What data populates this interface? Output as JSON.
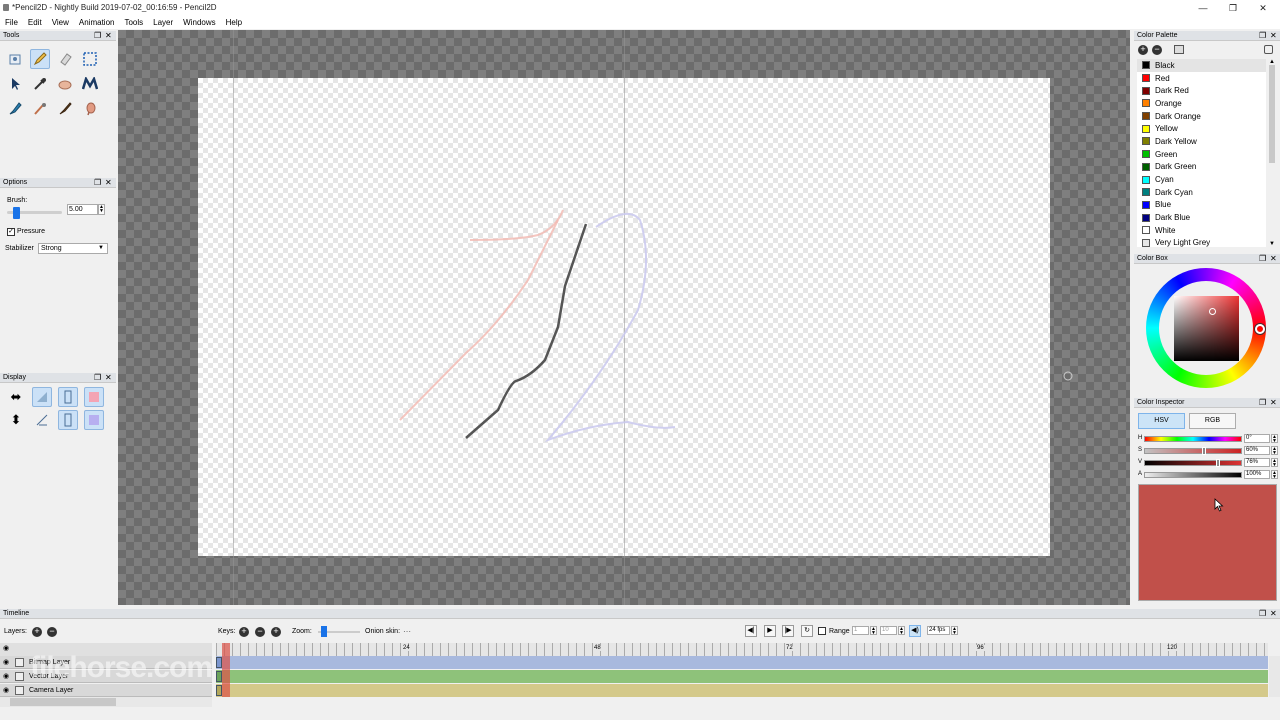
{
  "window": {
    "title": "*Pencil2D - Nightly Build 2019-07-02_00:16:59 - Pencil2D"
  },
  "menu": [
    "File",
    "Edit",
    "View",
    "Animation",
    "Tools",
    "Layer",
    "Windows",
    "Help"
  ],
  "panels": {
    "tools": "Tools",
    "options": "Options",
    "display": "Display",
    "color_palette": "Color Palette",
    "color_box": "Color Box",
    "color_inspector": "Color Inspector",
    "timeline": "Timeline"
  },
  "options": {
    "brush_label": "Brush:",
    "brush_value": "5.00",
    "pressure_label": "Pressure",
    "stabilizer_label": "Stabilizer",
    "stabilizer_value": "Strong"
  },
  "palette": [
    {
      "name": "Black",
      "color": "#000000"
    },
    {
      "name": "Red",
      "color": "#ff0000"
    },
    {
      "name": "Dark Red",
      "color": "#800000"
    },
    {
      "name": "Orange",
      "color": "#ff8000"
    },
    {
      "name": "Dark Orange",
      "color": "#804000"
    },
    {
      "name": "Yellow",
      "color": "#ffff00"
    },
    {
      "name": "Dark Yellow",
      "color": "#808000"
    },
    {
      "name": "Green",
      "color": "#00c000"
    },
    {
      "name": "Dark Green",
      "color": "#006000"
    },
    {
      "name": "Cyan",
      "color": "#00ffff"
    },
    {
      "name": "Dark Cyan",
      "color": "#008080"
    },
    {
      "name": "Blue",
      "color": "#0000ff"
    },
    {
      "name": "Dark Blue",
      "color": "#000080"
    },
    {
      "name": "White",
      "color": "#ffffff"
    },
    {
      "name": "Very Light Grey",
      "color": "#e6e6e6"
    }
  ],
  "inspector": {
    "tab_hsv": "HSV",
    "tab_rgb": "RGB",
    "h_label": "H",
    "h_value": "0°",
    "s_label": "S",
    "s_value": "60%",
    "v_label": "V",
    "v_value": "76%",
    "a_label": "A",
    "a_value": "100%",
    "current_color": "#c1504a"
  },
  "timeline": {
    "layers_label": "Layers:",
    "keys_label": "Keys:",
    "zoom_label": "Zoom:",
    "onion_label": "Onion skin:",
    "range_label": "Range",
    "range_start": "1",
    "range_end": "10",
    "fps": "24 fps",
    "ruler": [
      "24",
      "48",
      "72",
      "96",
      "120"
    ],
    "layers": [
      {
        "name": "Bitmap Layer",
        "color": "#a8b9de"
      },
      {
        "name": "Vector Layer",
        "color": "#8ec27a"
      },
      {
        "name": "Camera Layer",
        "color": "#d4c98a"
      }
    ]
  },
  "watermark": "filehorse.com"
}
